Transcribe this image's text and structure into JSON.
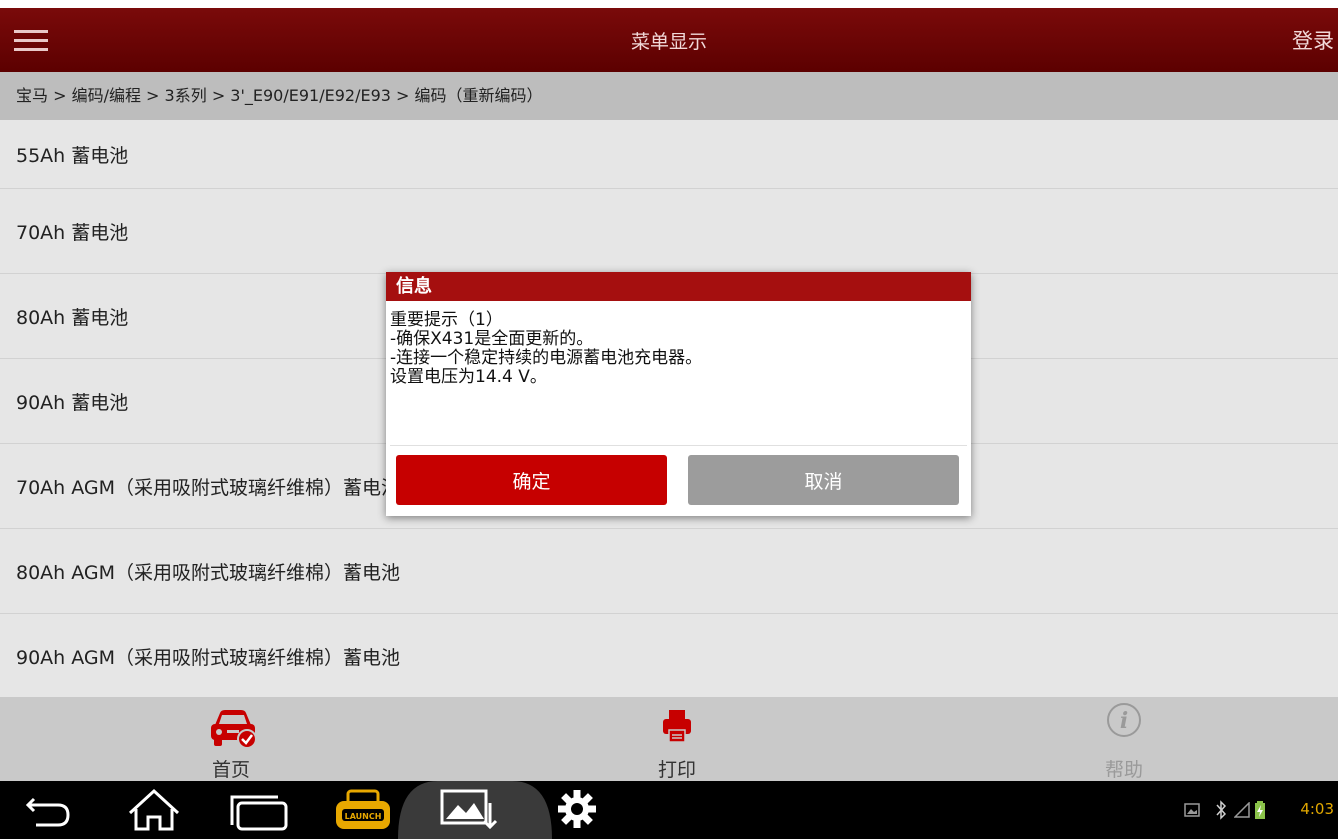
{
  "header": {
    "title": "菜单显示",
    "login_label": "登录"
  },
  "breadcrumb": "宝马 > 编码/编程 > 3系列 > 3'_E90/E91/E92/E93 > 编码（重新编码）",
  "list_items": [
    "55Ah 蓄电池",
    "70Ah 蓄电池",
    "80Ah 蓄电池",
    "90Ah 蓄电池",
    "70Ah AGM（采用吸附式玻璃纤维棉）蓄电池",
    "80Ah AGM（采用吸附式玻璃纤维棉）蓄电池",
    "90Ah AGM（采用吸附式玻璃纤维棉）蓄电池"
  ],
  "dialog": {
    "title": "信息",
    "lines": [
      "重要提示（1）",
      "-确保X431是全面更新的。",
      "-连接一个稳定持续的电源蓄电池充电器。",
      "设置电压为14.4 V。"
    ],
    "ok_label": "确定",
    "cancel_label": "取消"
  },
  "bottom_nav": {
    "home": "首页",
    "print": "打印",
    "help": "帮助"
  },
  "system_bar": {
    "icons": [
      "back-icon",
      "home-icon",
      "recent-apps-icon",
      "launch-app-icon",
      "screenshot-icon",
      "settings-icon"
    ],
    "clock": "4:03"
  },
  "colors": {
    "header": "#6a0505",
    "accent": "#c60000",
    "dialog_title": "#a50f0f",
    "clock": "#e2a800"
  }
}
